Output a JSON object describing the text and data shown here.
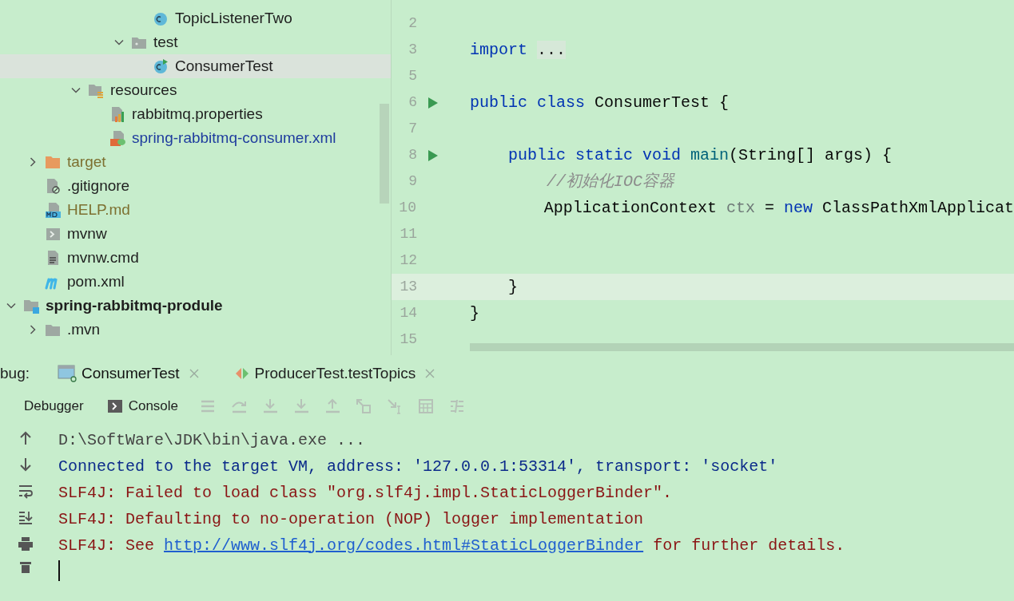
{
  "project_tree": [
    {
      "children": [
        {
          "children": [
            {
              "children": [
                {
                  "children": [
                    {
                      "children": [
                        {
                          "children": [
                            {
                              "label": "TopicListenerTwo",
                              "kind": "class",
                              "selected": false
                            }
                          ]
                        },
                        {
                          "label": "test",
                          "kind": "package",
                          "expanded": true,
                          "selected": false,
                          "children": [
                            {
                              "label": "ConsumerTest",
                              "kind": "runnable-class",
                              "selected": true
                            }
                          ]
                        }
                      ]
                    }
                  ]
                },
                {
                  "label": "resources",
                  "kind": "resources-folder",
                  "expanded": true,
                  "selected": false,
                  "children": [
                    {
                      "label": "rabbitmq.properties",
                      "kind": "properties",
                      "selected": false
                    },
                    {
                      "label": "spring-rabbitmq-consumer.xml",
                      "kind": "spring-xml",
                      "selected": false,
                      "color": "#1f3c9e"
                    }
                  ]
                }
              ]
            }
          ]
        },
        {
          "label": "target",
          "kind": "excluded-folder",
          "expanded": false,
          "selected": false,
          "color": "#7d7030"
        },
        {
          "label": ".gitignore",
          "kind": "ignore-file",
          "selected": false
        },
        {
          "label": "HELP.md",
          "kind": "markdown",
          "selected": false,
          "color": "#7d7030"
        },
        {
          "label": "mvnw",
          "kind": "script",
          "selected": false
        },
        {
          "label": "mvnw.cmd",
          "kind": "text-file",
          "selected": false
        },
        {
          "label": "pom.xml",
          "kind": "maven",
          "selected": false
        }
      ]
    },
    {
      "label": "spring-rabbitmq-produle",
      "kind": "module",
      "bold": true,
      "expanded": true,
      "selected": false,
      "children": [
        {
          "label": ".mvn",
          "kind": "folder",
          "expanded": false,
          "selected": false
        }
      ]
    }
  ],
  "editor": {
    "lines": [
      {
        "number": "2"
      },
      {
        "number": "3",
        "segments": [
          {
            "kind": "keyword",
            "text": "import "
          },
          {
            "kind": "fold",
            "text": "..."
          }
        ]
      },
      {
        "number": "5"
      },
      {
        "number": "6",
        "run": true,
        "segments": [
          {
            "kind": "keyword",
            "text": "public class"
          },
          {
            "kind": "plain",
            "text": " ConsumerTest {"
          }
        ]
      },
      {
        "number": "7"
      },
      {
        "number": "8",
        "run": true,
        "segments": [
          {
            "kind": "keyword",
            "text": "    public static void "
          },
          {
            "kind": "method",
            "text": "main"
          },
          {
            "kind": "plain",
            "text": "(String[] args) {"
          }
        ]
      },
      {
        "number": "9",
        "segments": [
          {
            "kind": "comment",
            "text": "        //初始化IOC容器"
          }
        ]
      },
      {
        "number": "10",
        "segments": [
          {
            "kind": "plain",
            "text": "        ApplicationContext "
          },
          {
            "kind": "variable",
            "text": "ctx"
          },
          {
            "kind": "plain",
            "text": " = "
          },
          {
            "kind": "keyword",
            "text": "new"
          },
          {
            "kind": "plain",
            "text": " ClassPathXmlApplicat"
          }
        ]
      },
      {
        "number": "11"
      },
      {
        "number": "12"
      },
      {
        "number": "13",
        "current": true,
        "segments": [
          {
            "kind": "plain",
            "text": "    }"
          }
        ]
      },
      {
        "number": "14",
        "segments": [
          {
            "kind": "plain",
            "text": "}"
          }
        ]
      },
      {
        "number": "15"
      }
    ]
  },
  "debug_panel": {
    "label": "bug:",
    "sessions": [
      {
        "label": "ConsumerTest",
        "kind": "app",
        "selected": true
      },
      {
        "label": "ProducerTest.testTopics",
        "kind": "test",
        "selected": false
      }
    ],
    "views": [
      {
        "label": "Debugger",
        "kind": "plain"
      },
      {
        "label": "Console",
        "kind": "console"
      }
    ],
    "actions": [
      {
        "kind": "frames",
        "disabled": true
      },
      {
        "kind": "step-over",
        "disabled": true
      },
      {
        "kind": "step-into",
        "disabled": true
      },
      {
        "kind": "force-step-into",
        "disabled": true
      },
      {
        "kind": "step-out",
        "disabled": true
      },
      {
        "kind": "drop-frame",
        "disabled": true
      },
      {
        "kind": "run-to-cursor",
        "disabled": true
      },
      {
        "kind": "evaluate",
        "disabled": true
      },
      {
        "kind": "trace",
        "disabled": true
      }
    ],
    "console": [
      {
        "kind": "command",
        "segments": [
          {
            "text": "D:\\SoftWare\\JDK\\bin\\java.exe ..."
          }
        ]
      },
      {
        "kind": "info",
        "segments": [
          {
            "text": "Connected to the target VM, address: '127.0.0.1:53314', transport: 'socket'"
          }
        ]
      },
      {
        "kind": "error",
        "segments": [
          {
            "text": "SLF4J: Failed to load class \"org.slf4j.impl.StaticLoggerBinder\"."
          }
        ]
      },
      {
        "kind": "error",
        "segments": [
          {
            "text": "SLF4J: Defaulting to no-operation (NOP) logger implementation"
          }
        ]
      },
      {
        "kind": "error",
        "segments": [
          {
            "text": "SLF4J: See "
          },
          {
            "text": "http://www.slf4j.org/codes.html#StaticLoggerBinder",
            "kind": "link"
          },
          {
            "text": " for further details."
          }
        ]
      }
    ]
  }
}
